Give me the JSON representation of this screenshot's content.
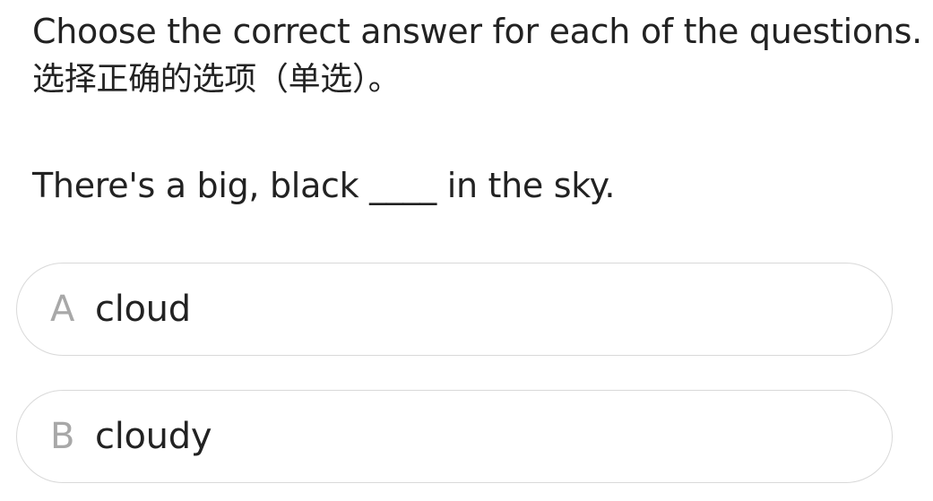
{
  "instructions": {
    "english": "Choose the correct answer for each of the questions.",
    "chinese": "选择正确的选项（单选）。"
  },
  "question": {
    "text": "There's a big, black ____ in the sky."
  },
  "options": [
    {
      "letter": "A",
      "text": "cloud"
    },
    {
      "letter": "B",
      "text": "cloudy"
    }
  ],
  "colors": {
    "text": "#222222",
    "option_letter": "#a8a8a8",
    "option_border": "#d9d9d9",
    "background": "#ffffff"
  }
}
